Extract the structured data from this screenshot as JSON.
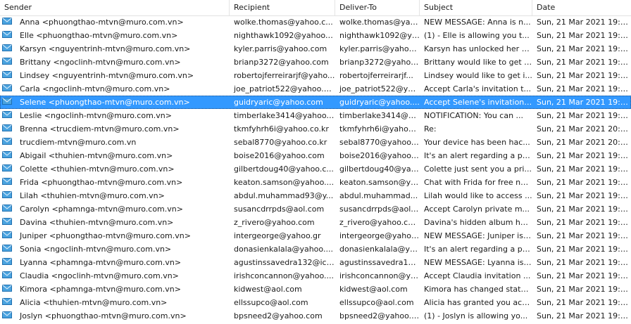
{
  "columns": {
    "sender": "Sender",
    "recipient": "Recipient",
    "deliver_to": "Deliver-To",
    "subject": "Subject",
    "date": "Date"
  },
  "icon": "envelope-icon",
  "colors": {
    "selected_row": "#3399ff",
    "icon": "#4aa3df"
  },
  "rows": [
    {
      "sender": "Anna <phuongthao-mtvn@muro.com.vn>",
      "recipient": "wolke.thomas@yahoo.c...",
      "deliver_to": "wolke.thomas@yahoo...",
      "subject": "NEW MESSAGE: Anna is n...",
      "date": "Sun, 21 Mar 2021 19:07:2..."
    },
    {
      "sender": "Elle <phuongthao-mtvn@muro.com.vn>",
      "recipient": "nighthawk1092@yahoo.c...",
      "deliver_to": "nighthawk1092@yaho...",
      "subject": "(1) - Elle is allowing you t...",
      "date": "Sun, 21 Mar 2021 19:07:2..."
    },
    {
      "sender": "Karsyn <nguyentrinh-mtvn@muro.com.vn>",
      "recipient": "kyler.parris@yahoo.com",
      "deliver_to": "kyler.parris@yahoo....",
      "subject": "Karsyn has unlocked her p...",
      "date": "Sun, 21 Mar 2021 19:07:5..."
    },
    {
      "sender": "Brittany <ngoclinh-mtvn@muro.com.vn>",
      "recipient": "brianp3272@yahoo.com",
      "deliver_to": "brianp3272@yahoo.c...",
      "subject": "Brittany would like to get i...",
      "date": "Sun, 21 Mar 2021 19:08:2..."
    },
    {
      "sender": "Lindsey <nguyentrinh-mtvn@muro.com.vn>",
      "recipient": "robertojferreirarjf@yaho...",
      "deliver_to": "robertojferreirarjf...",
      "subject": "Lindsey would like to get i...",
      "date": "Sun, 21 Mar 2021 19:08:1..."
    },
    {
      "sender": "Carla <ngoclinh-mtvn@muro.com.vn>",
      "recipient": "joe_patriot522@yahoo.c...",
      "deliver_to": "joe_patriot522@yah...",
      "subject": "Accept Carla's invitation t...",
      "date": "Sun, 21 Mar 2021 19:09:3..."
    },
    {
      "sender": "Selene <phuongthao-mtvn@muro.com.vn>",
      "recipient": "guidryaric@yahoo.com",
      "deliver_to": "guidryaric@yahoo....",
      "subject": "Accept Selene's invitation ...",
      "date": "Sun, 21 Mar 2021 19:09:3...",
      "selected": true
    },
    {
      "sender": "Leslie <ngoclinh-mtvn@muro.com.vn>",
      "recipient": "timberlake3414@yahoo....",
      "deliver_to": "timberlake3414@yah...",
      "subject": "NOTIFICATION: You can ...",
      "date": "Sun, 21 Mar 2021 19:09:5..."
    },
    {
      "sender": "Brenna <trucdiem-mtvn@muro.com.vn>",
      "recipient": "tkmfyhrh6i@yahoo.co.kr",
      "deliver_to": "tkmfyhrh6i@yahoo....",
      "subject": "Re:",
      "date": "Sun, 21 Mar 2021 20:12:5..."
    },
    {
      "sender": "trucdiem-mtvn@muro.com.vn",
      "recipient": "sebal8770@yahoo.co.kr",
      "deliver_to": "sebal8770@yahoo.co...",
      "subject": "Your device has been hac...",
      "date": "Sun, 21 Mar 2021 20:13:0..."
    },
    {
      "sender": "Abigail <thuhien-mtvn@muro.com.vn>",
      "recipient": "boise2016@yahoo.com",
      "deliver_to": "boise2016@yahoo.co...",
      "subject": "It's an alert regarding a pri...",
      "date": "Sun, 21 Mar 2021 19:14:2..."
    },
    {
      "sender": "Colette <thuhien-mtvn@muro.com.vn>",
      "recipient": "gilbertdoug40@yahoo.c...",
      "deliver_to": "gilbertdoug40@yah...",
      "subject": "Colette just sent you a pri...",
      "date": "Sun, 21 Mar 2021 19:15:1..."
    },
    {
      "sender": "Frida <phuongthao-mtvn@muro.com.vn>",
      "recipient": "keaton.samson@yahoo....",
      "deliver_to": "keaton.samson@yah...",
      "subject": "Chat with Frida for free nu...",
      "date": "Sun, 21 Mar 2021 19:15:1..."
    },
    {
      "sender": "Lilah <thuhien-mtvn@muro.com.vn>",
      "recipient": "abdul.muhammad93@y...",
      "deliver_to": "abdul.muhammad...",
      "subject": "Lilah would like to access ...",
      "date": "Sun, 21 Mar 2021 19:15:2..."
    },
    {
      "sender": "Carolyn <phamnga-mtvn@muro.com.vn>",
      "recipient": "susancdrrpds@aol.com",
      "deliver_to": "susancdrrpds@aol....",
      "subject": "Accept Carolyn private m...",
      "date": "Sun, 21 Mar 2021 19:15:2..."
    },
    {
      "sender": "Davina <thuhien-mtvn@muro.com.vn>",
      "recipient": "z_rivero@yahoo.com",
      "deliver_to": "z_rivero@yahoo.com",
      "subject": "Davina's hidden album ha...",
      "date": "Sun, 21 Mar 2021 19:15:2..."
    },
    {
      "sender": "Juniper <phuongthao-mtvn@muro.com.vn>",
      "recipient": "intergeorge@yahoo.gr",
      "deliver_to": "intergeorge@yahoo.gr",
      "subject": "NEW MESSAGE: Juniper is ...",
      "date": "Sun, 21 Mar 2021 19:16:0..."
    },
    {
      "sender": "Sonia <ngoclinh-mtvn@muro.com.vn>",
      "recipient": "donasienkalala@yahoo....",
      "deliver_to": "donasienkalala@yah...",
      "subject": "It's an alert regarding a pri...",
      "date": "Sun, 21 Mar 2021 19:16:0..."
    },
    {
      "sender": "Lyanna <phamnga-mtvn@muro.com.vn>",
      "recipient": "agustinssavedra132@icl...",
      "deliver_to": "agustinssavedra13...",
      "subject": "NEW MESSAGE: Lyanna is ...",
      "date": "Sun, 21 Mar 2021 19:16:0..."
    },
    {
      "sender": "Claudia <ngoclinh-mtvn@muro.com.vn>",
      "recipient": "irishconcannon@yahoo....",
      "deliver_to": "irishconcannon@yah...",
      "subject": "Accept Claudia invitation ...",
      "date": "Sun, 21 Mar 2021 19:16:1..."
    },
    {
      "sender": "Kimora <phamnga-mtvn@muro.com.vn>",
      "recipient": "kidwest@aol.com",
      "deliver_to": "kidwest@aol.com",
      "subject": "Kimora has changed statu...",
      "date": "Sun, 21 Mar 2021 19:16:2..."
    },
    {
      "sender": "Alicia <thuhien-mtvn@muro.com.vn>",
      "recipient": "ellssupco@aol.com",
      "deliver_to": "ellssupco@aol.com",
      "subject": "Alicia has granted you acc...",
      "date": "Sun, 21 Mar 2021 19:16:2..."
    },
    {
      "sender": "Joslyn <phuongthao-mtvn@muro.com.vn>",
      "recipient": "bpsneed2@yahoo.com",
      "deliver_to": "bpsneed2@yahoo.com",
      "subject": "(1) - Joslyn is allowing yo...",
      "date": "Sun, 21 Mar 2021 19:16:3..."
    }
  ]
}
